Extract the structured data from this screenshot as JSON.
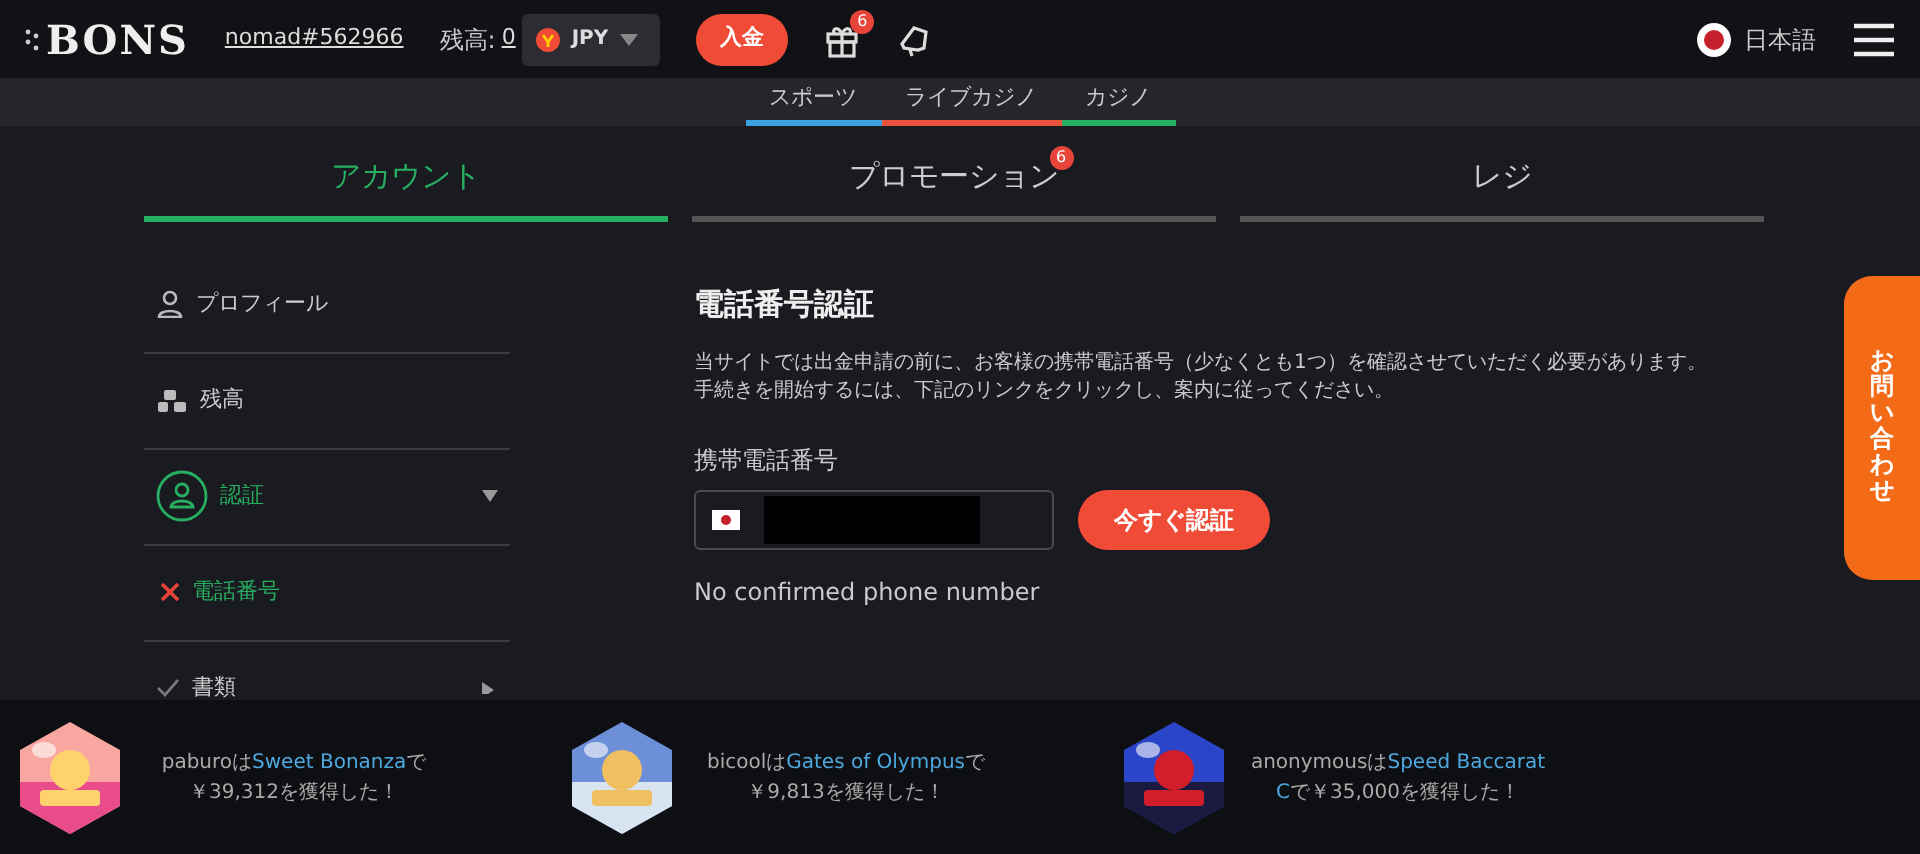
{
  "header": {
    "logo": "BONS",
    "username": "nomad#562966",
    "balance_label": "残高:",
    "balance_value": "0",
    "currency": "JPY",
    "deposit_button": "入金",
    "gift_badge": "6",
    "language": "日本語"
  },
  "subnav": [
    {
      "label": "スポーツ",
      "color": "#3aa0e0"
    },
    {
      "label": "ライブカジノ",
      "color": "#e8533c"
    },
    {
      "label": "カジノ",
      "color": "#27ae60"
    }
  ],
  "tabs": [
    {
      "label": "アカウント",
      "selected": true
    },
    {
      "label": "プロモーション",
      "selected": false,
      "badge": "6"
    },
    {
      "label": "レジ",
      "selected": false
    }
  ],
  "sidebar": {
    "items": [
      {
        "label": "プロフィール",
        "kind": "link",
        "selected": false
      },
      {
        "label": "残高",
        "kind": "link",
        "selected": false
      },
      {
        "label": "認証",
        "kind": "group",
        "selected": true,
        "expanded": true,
        "children": [
          {
            "label": "電話番号",
            "verified": false
          }
        ]
      },
      {
        "label": "書類",
        "kind": "group",
        "selected": false,
        "expanded": false
      }
    ]
  },
  "content": {
    "title": "電話番号認証",
    "description": [
      "当サイトでは出金申請の前に、お客様の携帯電話番号（少なくとも1つ）を確認させていただく必要があります。",
      "手続きを開始するには、下記のリンクをクリックし、案内に従ってください。"
    ],
    "phone_label": "携帯電話番号",
    "verify_button": "今すぐ認証",
    "status_note": "No confirmed phone number"
  },
  "contact_tab": "お問い合わせ",
  "ticker": [
    {
      "kind": "picture",
      "user": "paburo",
      "connector": "は",
      "game": "Sweet Bonanza",
      "result": "で￥39,312を獲得した！"
    },
    {
      "kind": "picture",
      "user": "bicool",
      "connector": "は",
      "game": "Gates of Olympus",
      "result": "で￥9,813を獲得した！"
    },
    {
      "kind": "picture",
      "user": "anonymous",
      "connector": "は",
      "game": "Speed Baccarat C",
      "result": "で￥35,000を獲得した！"
    }
  ]
}
